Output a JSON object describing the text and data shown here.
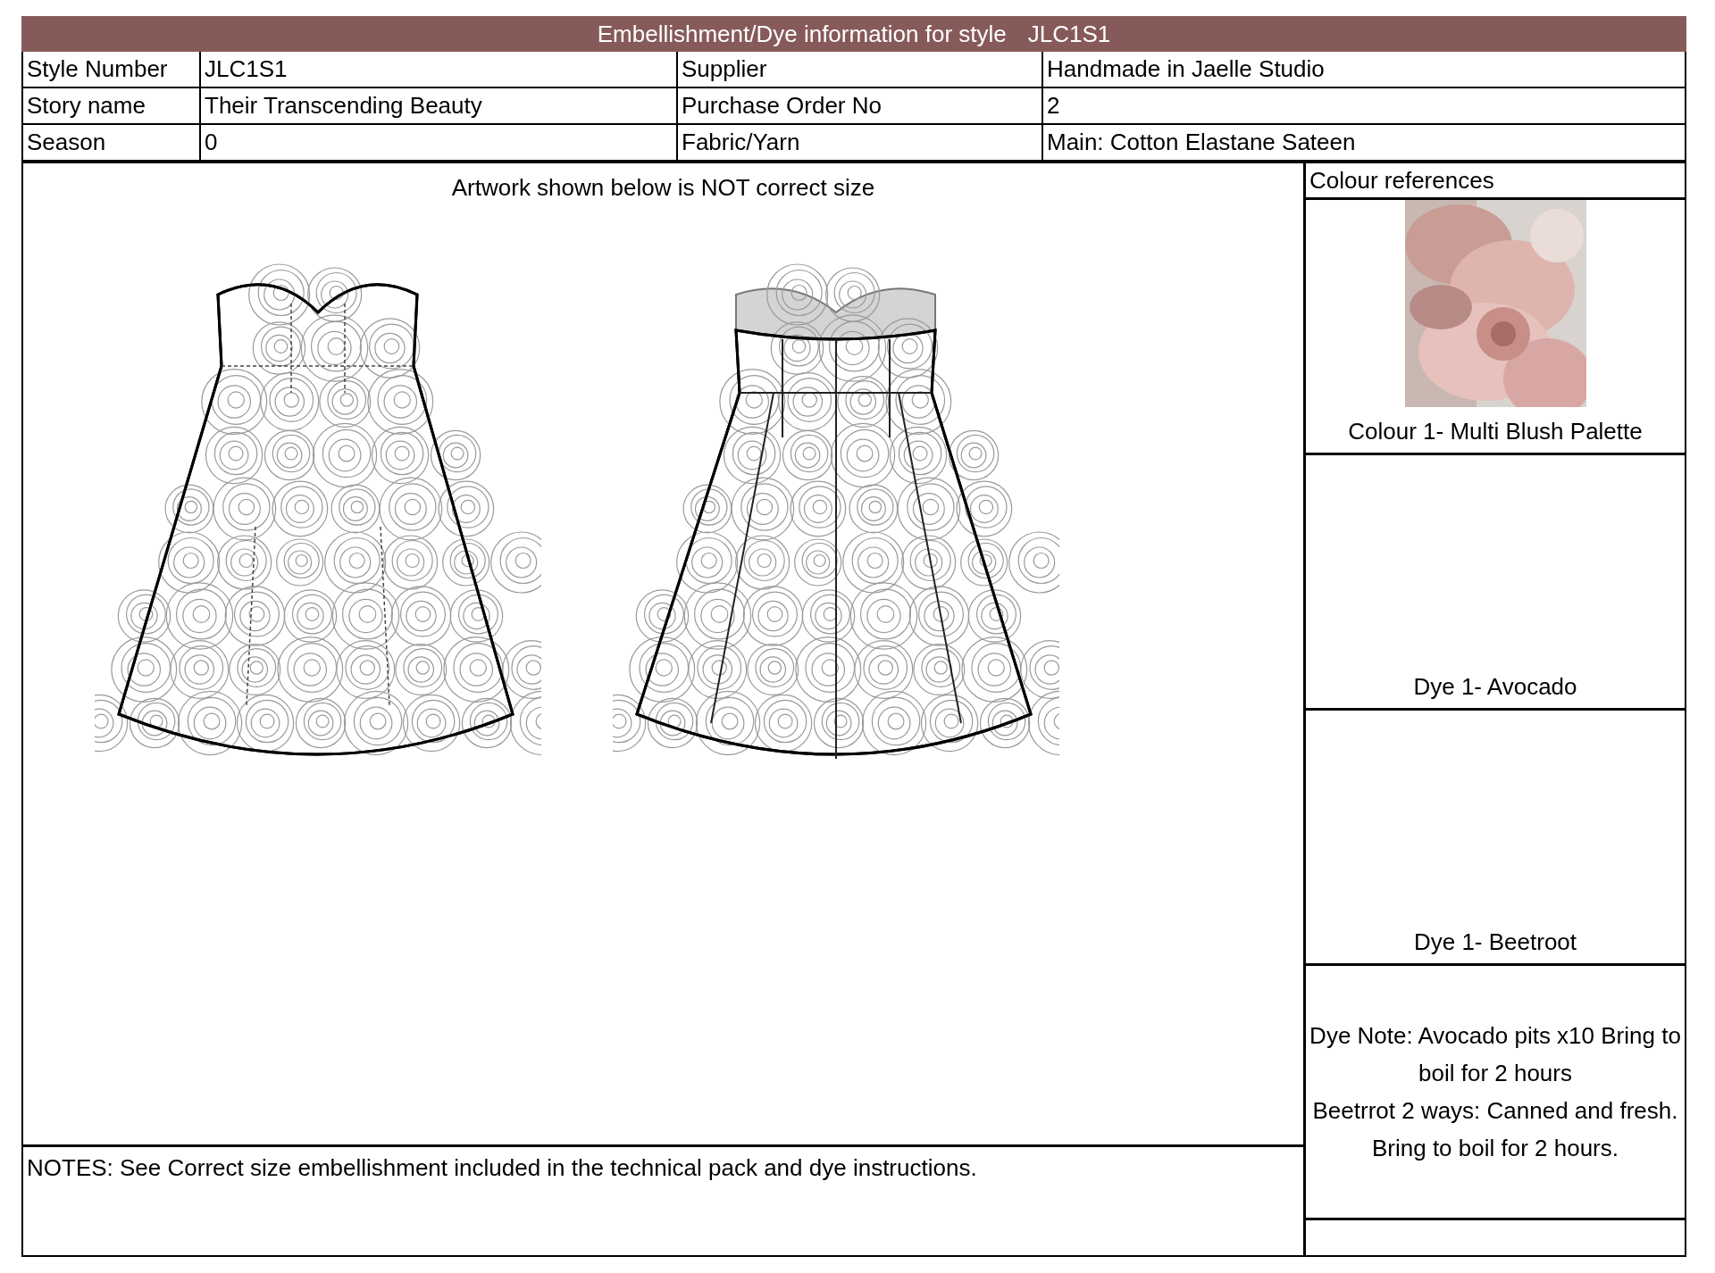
{
  "header": {
    "title": "Embellishment/Dye information for style",
    "style": "JLC1S1"
  },
  "info_rows": [
    {
      "label": "Style Number",
      "value": "JLC1S1",
      "label_2": "Supplier",
      "value_2": "Handmade in Jaelle Studio"
    },
    {
      "label": "Story name",
      "value": "Their Transcending Beauty",
      "label_2": "Purchase Order No",
      "value_2": "2"
    },
    {
      "label": "Season",
      "value": "0",
      "label_2": "Fabric/Yarn",
      "value_2": "Main: Cotton Elastane Sateen"
    }
  ],
  "artwork": {
    "caption": "Artwork shown below is NOT correct size",
    "views": [
      {
        "kind": "front"
      },
      {
        "kind": "back"
      }
    ]
  },
  "colour_panel": {
    "title": "Colour references",
    "swatches": [
      {
        "kind": "picture",
        "label": "Colour 1- Multi Blush Palette"
      },
      {
        "kind": "blank",
        "label": "Dye 1- Avocado"
      },
      {
        "kind": "blank",
        "label": "Dye 1- Beetroot"
      }
    ],
    "dye_note": [
      "Dye Note: Avocado pits x10 Bring to boil for 2 hours",
      "Beetrrot 2 ways: Canned and fresh.",
      "Bring to boil for 2 hours."
    ]
  },
  "notes": "NOTES: See Correct size embellishment included in the technical pack and dye instructions."
}
